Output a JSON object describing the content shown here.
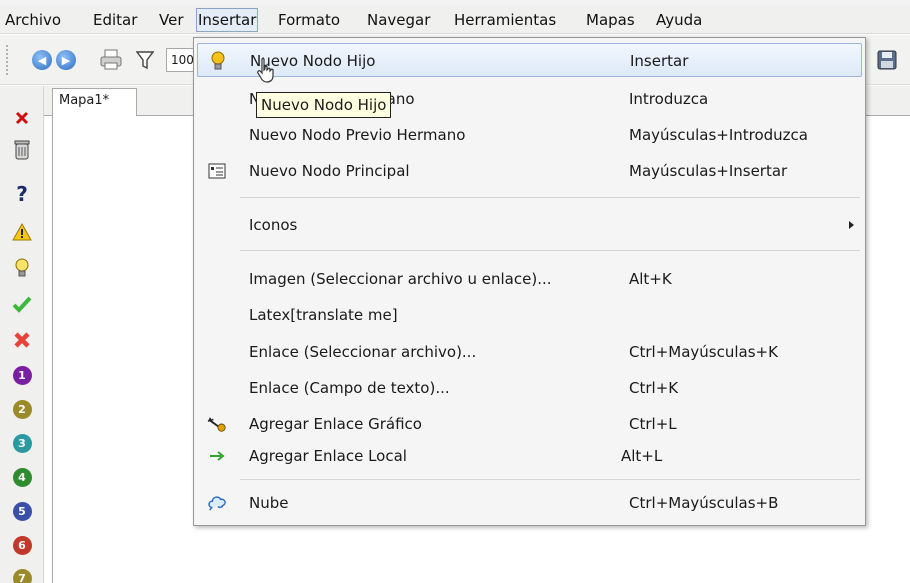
{
  "menubar": {
    "items": [
      "Archivo",
      "Editar",
      "Ver",
      "Insertar",
      "Formato",
      "Navegar",
      "Herramientas",
      "Mapas",
      "Ayuda"
    ],
    "active_index": 3
  },
  "toolbar": {
    "zoom_value": "100%",
    "icons": [
      "back-icon",
      "forward-icon",
      "print-icon",
      "filter-icon",
      "save-icon"
    ]
  },
  "tabs": [
    {
      "label": "Mapa1*"
    }
  ],
  "tooltip": "Nuevo Nodo Hijo",
  "dropdown": {
    "items": [
      {
        "label": "Nuevo Nodo Hijo",
        "shortcut": "Insertar",
        "icon": "lightbulb-icon",
        "hover": true
      },
      {
        "label": "Nuevo Nodo Hermano",
        "shortcut": "Introduzca",
        "icon": ""
      },
      {
        "label": "Nuevo Nodo Previo Hermano",
        "shortcut": "Mayúsculas+Introduzca",
        "icon": ""
      },
      {
        "label": "Nuevo Nodo Principal",
        "shortcut": "Mayúsculas+Insertar",
        "icon": "node-list-icon"
      },
      {
        "label": "Iconos",
        "shortcut": "",
        "icon": "",
        "submenu": true
      },
      {
        "label": "Imagen (Seleccionar archivo u enlace)...",
        "shortcut": "Alt+K",
        "icon": ""
      },
      {
        "label": "Latex[translate me]",
        "shortcut": "",
        "icon": ""
      },
      {
        "label": "Enlace (Seleccionar archivo)...",
        "shortcut": "Ctrl+Mayúsculas+K",
        "icon": ""
      },
      {
        "label": "Enlace (Campo de texto)...",
        "shortcut": "Ctrl+K",
        "icon": ""
      },
      {
        "label": "Agregar Enlace Gráfico",
        "shortcut": "Ctrl+L",
        "icon": "graphic-link-icon"
      },
      {
        "label": "Agregar Enlace Local",
        "shortcut": "Alt+L",
        "icon": "green-arrow-icon"
      },
      {
        "label": "Nube",
        "shortcut": "Ctrl+Mayúsculas+B",
        "icon": "cloud-icon"
      }
    ]
  },
  "leftbar": {
    "icons": [
      "remove-icon",
      "trash-icon",
      "question-icon",
      "warning-icon",
      "lightbulb-icon",
      "check-icon",
      "cross-icon",
      "priority-1-icon",
      "priority-2-icon",
      "priority-3-icon",
      "priority-4-icon",
      "priority-5-icon",
      "priority-6-icon",
      "priority-7-icon"
    ],
    "priorities": [
      "1",
      "2",
      "3",
      "4",
      "5",
      "6",
      "7"
    ]
  },
  "colors": {
    "priority": [
      "#7b1fa2",
      "#9a8a2a",
      "#2a9aa0",
      "#2e8b2e",
      "#3a50a8",
      "#c0392b",
      "#9a8a2a"
    ],
    "menu_hover": "#dde9f8",
    "tooltip_bg": "#ffffe1"
  }
}
